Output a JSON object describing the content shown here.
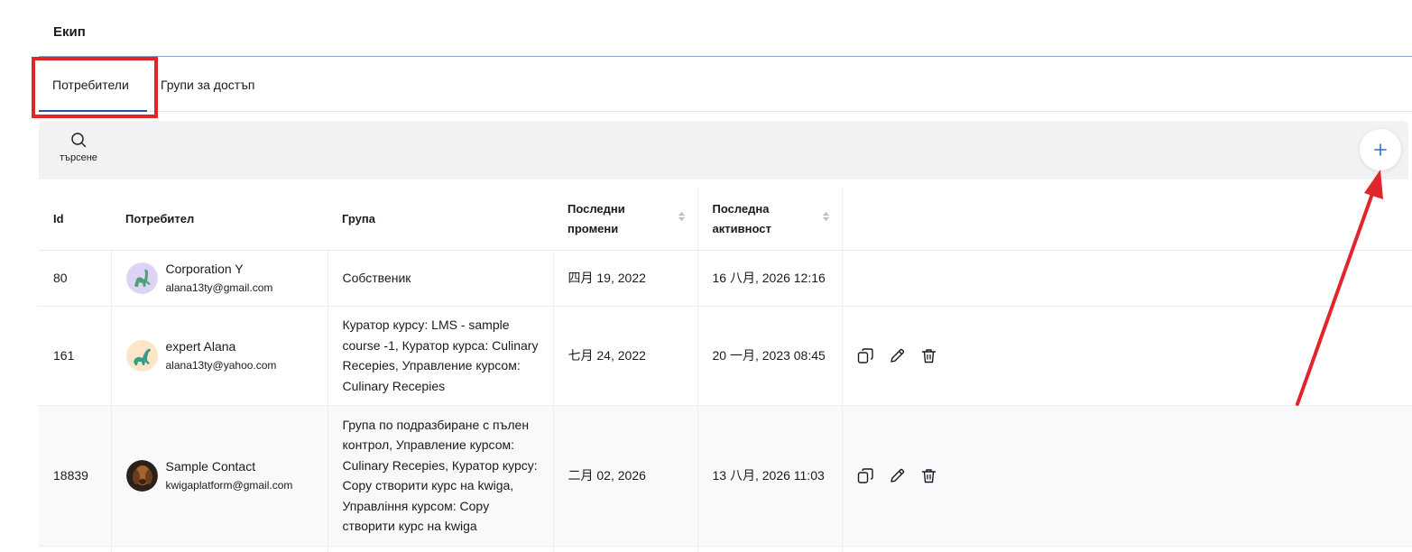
{
  "page": {
    "title": "Екип"
  },
  "tabs": [
    {
      "label": "Потребители",
      "active": true
    },
    {
      "label": "Групи за достъп",
      "active": false
    }
  ],
  "toolbar": {
    "search_label": "търсене",
    "add_icon": "plus-icon",
    "search_icon": "search-icon"
  },
  "table": {
    "headers": {
      "id": "Id",
      "user": "Потребител",
      "group": "Група",
      "last_changes": "Последни промени",
      "last_activity": "Последна активност"
    },
    "rows": [
      {
        "id": "80",
        "name": "Corporation Y",
        "email": "alana13ty@gmail.com",
        "group": "Собственик",
        "last_changes": "四月 19, 2022",
        "last_activity": "16 八月, 2026 12:16",
        "has_actions": false
      },
      {
        "id": "161",
        "name": "expert Alana",
        "email": "alana13ty@yahoo.com",
        "group": "Куратор курсу: LMS - sample course -1, Куратор курса: Culinary Recepies, Управление курсом: Culinary Recepies",
        "last_changes": "七月 24, 2022",
        "last_activity": "20 一月, 2023 08:45",
        "has_actions": true
      },
      {
        "id": "18839",
        "name": "Sample Contact",
        "email": "kwigaplatform@gmail.com",
        "group": "Група по подразбиране с пълен контрол, Управление курсом: Culinary Recepies, Куратор курсу: Copy створити курс на kwiga, Управління курсом: Copy створити курс на kwiga",
        "last_changes": "二月 02, 2026",
        "last_activity": "13 八月, 2026 11:03",
        "has_actions": true
      }
    ]
  },
  "colors": {
    "accent": "#2f4f9a",
    "annotation": "#e0252b",
    "plus": "#2f6fd6"
  }
}
